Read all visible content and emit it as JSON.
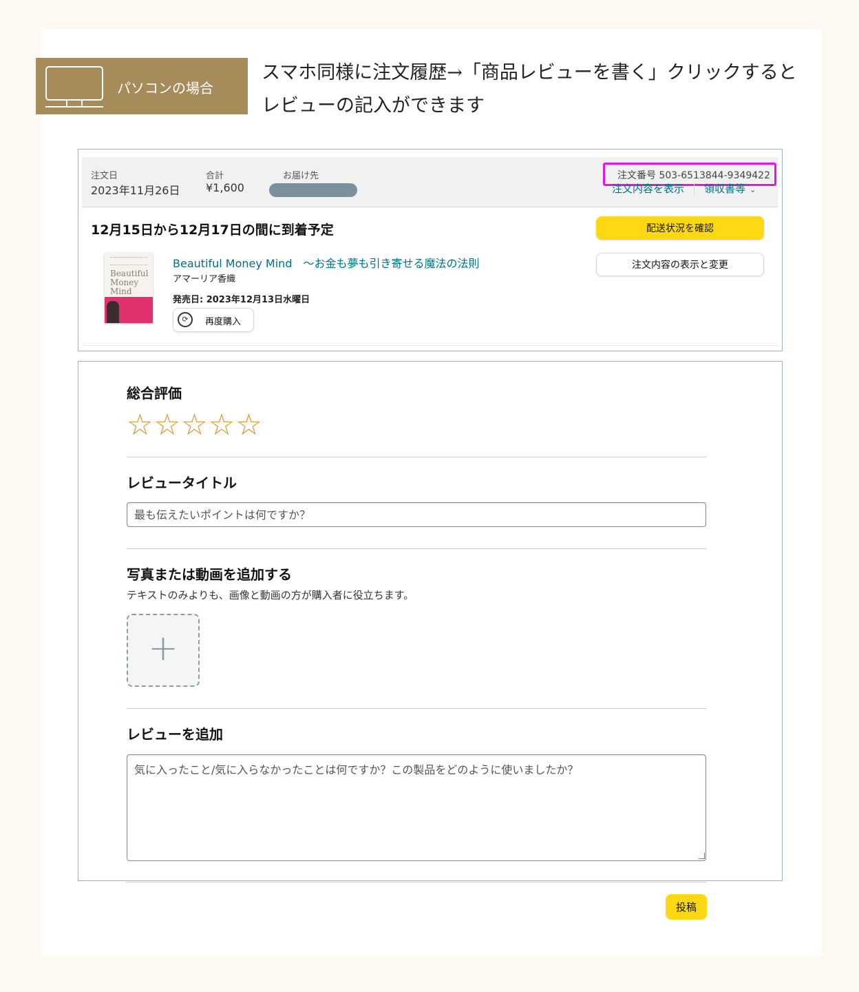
{
  "badge": {
    "label": "パソコンの場合",
    "icon": "monitor-icon"
  },
  "instruction": {
    "line1": "スマホ同様に注文履歴→「商品レビューを書く」クリックすると",
    "line2": "レビューの記入ができます"
  },
  "order": {
    "date_label": "注文日",
    "date_value": "2023年11月26日",
    "total_label": "合計",
    "total_value": "¥1,600",
    "ship_to_label": "お届け先",
    "order_number": "注文番号 503-6513844-9349422",
    "link_details": "注文内容を表示",
    "link_receipt": "領収書等",
    "delivery_status": "12月15日から12月17日の間に到着予定",
    "btn_track": "配送状況を確認",
    "btn_view_change": "注文内容の表示と変更",
    "book": {
      "title": "Beautiful Money Mind　～お金も夢も引き寄せる魔法の法則",
      "author": "アマーリア香織",
      "release": "発売日: 2023年12月13日水曜日",
      "cover_text": "Beautiful Money Mind",
      "rebuy_label": "再度購入"
    }
  },
  "review": {
    "overall_label": "総合評価",
    "rating_stars": 0,
    "rating_max": 5,
    "title_label": "レビュータイトル",
    "title_placeholder": "最も伝えたいポイントは何ですか？",
    "media_label": "写真または動画を追加する",
    "media_desc": "テキストのみよりも、画像と動画の方が購入者に役立ちます。",
    "add_review_label": "レビューを追加",
    "review_placeholder": "気に入ったこと/気に入らなかったことは何ですか？この製品をどのように使いましたか？",
    "submit_label": "投稿"
  },
  "colors": {
    "badge": "#a68b5b",
    "highlight": "#ea12e8",
    "link": "#007185",
    "button_yellow": "#ffd814",
    "star": "#d39a3b"
  }
}
